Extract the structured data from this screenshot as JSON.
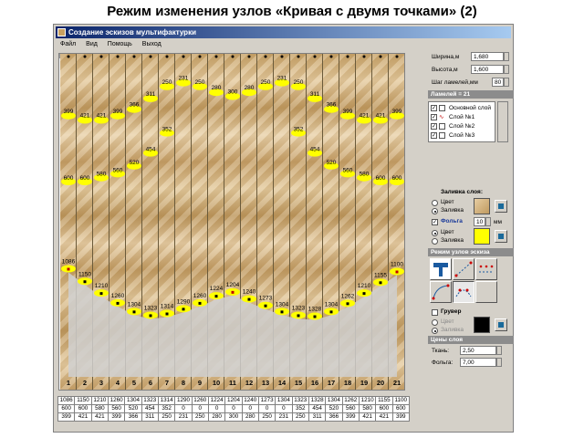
{
  "slide_title": "Режим изменения узлов «Кривая с двумя точками» (2)",
  "window": {
    "title": "Создание эскизов мультифактурки",
    "menu": [
      "Файл",
      "Вид",
      "Помощь",
      "Выход"
    ]
  },
  "columns": {
    "numbers": [
      "1",
      "2",
      "3",
      "4",
      "5",
      "6",
      "7",
      "8",
      "9",
      "10",
      "11",
      "12",
      "13",
      "14",
      "15",
      "16",
      "17",
      "18",
      "19",
      "20",
      "21"
    ],
    "lower_nodes": [
      "1086",
      "1150",
      "1210",
      "1260",
      "1304",
      "1323",
      "1314",
      "1290",
      "1260",
      "1224",
      "1204",
      "1240",
      "1273",
      "1304",
      "1323",
      "1328",
      "1304",
      "1262",
      "1210",
      "1155",
      "1100"
    ],
    "upper_nodes": [
      "399",
      "421",
      "421",
      "399",
      "366",
      "311",
      "250",
      "231",
      "250",
      "280",
      "300",
      "280",
      "250",
      "231",
      "250",
      "311",
      "366",
      "399",
      "421",
      "421",
      "399"
    ],
    "middle_nodes": [
      "600",
      "600",
      "580",
      "560",
      "520",
      "454",
      "352",
      "0",
      "0",
      "0",
      "0",
      "0",
      "0",
      "0",
      "352",
      "454",
      "520",
      "560",
      "580",
      "600",
      "600"
    ]
  },
  "table": {
    "rows": [
      [
        "1086",
        "1150",
        "1210",
        "1260",
        "1304",
        "1323",
        "1314",
        "1290",
        "1260",
        "1224",
        "1204",
        "1240",
        "1273",
        "1304",
        "1323",
        "1328",
        "1304",
        "1262",
        "1210",
        "1155",
        "1100"
      ],
      [
        "600",
        "600",
        "580",
        "560",
        "520",
        "454",
        "352",
        "0",
        "0",
        "0",
        "0",
        "0",
        "0",
        "0",
        "352",
        "454",
        "520",
        "560",
        "580",
        "600",
        "600"
      ],
      [
        "399",
        "421",
        "421",
        "399",
        "366",
        "311",
        "250",
        "231",
        "250",
        "280",
        "300",
        "280",
        "250",
        "231",
        "250",
        "311",
        "366",
        "399",
        "421",
        "421",
        "399"
      ]
    ]
  },
  "panel": {
    "width_label": "Ширина,м",
    "width_value": "1,680",
    "height_label": "Высота,м",
    "height_value": "1,600",
    "step_label": "Шаг ламелей,мм",
    "step_value": "80",
    "lamels_header": "Ламелей = 21",
    "layers": [
      "Основной слой",
      "Слой №1",
      "Слой №2",
      "Слой №3"
    ],
    "fill_header": "Заливка слоя:",
    "fill_options": [
      "Цвет",
      "Заливка"
    ],
    "foil_label": "Фольга",
    "foil_value": "10",
    "foil_unit": "мм",
    "foil_options": [
      "Цвет",
      "Заливка"
    ],
    "mode_header": "Режим узлов эскиза",
    "gruver_label": "Грувер",
    "gruver_options": [
      "Цвет",
      "Заливка"
    ],
    "prices_header": "Цены слоя",
    "fabric_label": "Ткань:",
    "fabric_value": "2,50",
    "foil_price_label": "Фольга:",
    "foil_price_value": "7,00"
  },
  "colors": {
    "highlight": "#ffff00",
    "title_bar": "#0a246a",
    "window_bg": "#d4d0c8"
  }
}
